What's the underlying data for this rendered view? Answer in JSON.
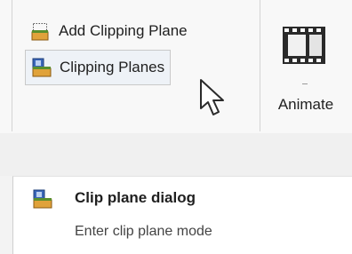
{
  "ribbon": {
    "add_clipping_plane": "Add Clipping Plane",
    "clipping_planes": "Clipping Planes",
    "animate": "Animate"
  },
  "tooltip": {
    "title": "Clip plane dialog",
    "description": "Enter clip plane mode"
  },
  "icons": {
    "add_clipping_plane": "add-clip-plane-icon",
    "clipping_planes": "clip-planes-icon",
    "animate": "film-strip-icon",
    "cursor": "mouse-pointer-icon"
  },
  "colors": {
    "icon_orange": "#e0a23a",
    "icon_green": "#5a8f2c",
    "icon_blue": "#3a66b8",
    "hover_bg": "#eef2f7"
  }
}
